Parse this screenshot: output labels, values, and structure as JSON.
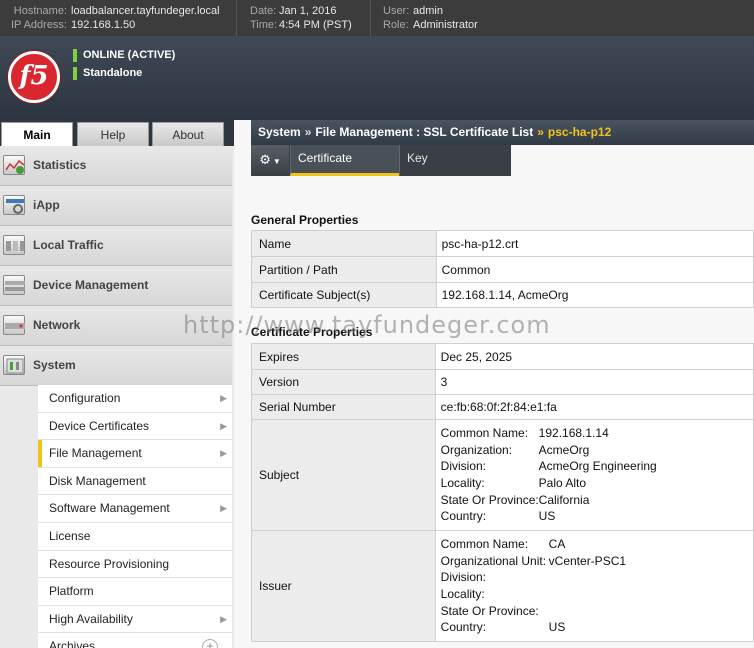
{
  "topbar": {
    "hostname_label": "Hostname:",
    "hostname": "loadbalancer.tayfundeger.local",
    "ip_label": "IP Address:",
    "ip": "192.168.1.50",
    "date_label": "Date:",
    "date": "Jan 1, 2016",
    "time_label": "Time:",
    "time": "4:54 PM (PST)",
    "user_label": "User:",
    "user": "admin",
    "role_label": "Role:",
    "role": "Administrator"
  },
  "header": {
    "logo_text": "f5",
    "status_online": "ONLINE (ACTIVE)",
    "status_mode": "Standalone"
  },
  "tabs": {
    "main": "Main",
    "help": "Help",
    "about": "About"
  },
  "sidebar": {
    "items": [
      {
        "label": "Statistics",
        "icon": "statistics-icon"
      },
      {
        "label": "iApp",
        "icon": "iapp-icon"
      },
      {
        "label": "Local Traffic",
        "icon": "local-traffic-icon"
      },
      {
        "label": "Device Management",
        "icon": "device-management-icon"
      },
      {
        "label": "Network",
        "icon": "network-icon"
      },
      {
        "label": "System",
        "icon": "system-icon"
      }
    ],
    "submenu": [
      {
        "label": "Configuration",
        "has_children": true
      },
      {
        "label": "Device Certificates",
        "has_children": true
      },
      {
        "label": "File Management",
        "has_children": true,
        "active": true
      },
      {
        "label": "Disk Management",
        "has_children": false
      },
      {
        "label": "Software Management",
        "has_children": true
      },
      {
        "label": "License",
        "has_children": false
      },
      {
        "label": "Resource Provisioning",
        "has_children": false
      },
      {
        "label": "Platform",
        "has_children": false
      },
      {
        "label": "High Availability",
        "has_children": true
      },
      {
        "label": "Archives",
        "has_children": false
      }
    ]
  },
  "breadcrumb": {
    "part1": "System",
    "part2": "File Management : SSL Certificate List",
    "current": "psc-ha-p12",
    "separator": "»"
  },
  "page_tabs": {
    "certificate": "Certificate",
    "key": "Key"
  },
  "general": {
    "title": "General Properties",
    "rows": [
      {
        "label": "Name",
        "value": "psc-ha-p12.crt"
      },
      {
        "label": "Partition / Path",
        "value": "Common"
      },
      {
        "label": "Certificate Subject(s)",
        "value": "192.168.1.14, AcmeOrg"
      }
    ]
  },
  "cert": {
    "title": "Certificate Properties",
    "expires_label": "Expires",
    "expires": "Dec 25, 2025",
    "version_label": "Version",
    "version": "3",
    "serial_label": "Serial Number",
    "serial": "ce:fb:68:0f:2f:84:e1:fa",
    "subject_label": "Subject",
    "subject": [
      {
        "k": "Common Name:",
        "v": "192.168.1.14"
      },
      {
        "k": "Organization:",
        "v": "AcmeOrg"
      },
      {
        "k": "Division:",
        "v": "AcmeOrg Engineering"
      },
      {
        "k": "Locality:",
        "v": "Palo Alto"
      },
      {
        "k": "State Or Province:",
        "v": "California"
      },
      {
        "k": "Country:",
        "v": "US"
      }
    ],
    "issuer_label": "Issuer",
    "issuer": [
      {
        "k": "Common Name:",
        "v": "CA"
      },
      {
        "k": "Organizational Unit:",
        "v": "vCenter-PSC1"
      },
      {
        "k": "Division:",
        "v": ""
      },
      {
        "k": "Locality:",
        "v": ""
      },
      {
        "k": "State Or Province:",
        "v": ""
      },
      {
        "k": "Country:",
        "v": "US"
      }
    ]
  },
  "watermark": "http://www.tayfundeger.com",
  "colors": {
    "accent": "#f0c419",
    "online": "#7ed23b",
    "logo_red": "#d9262f"
  }
}
